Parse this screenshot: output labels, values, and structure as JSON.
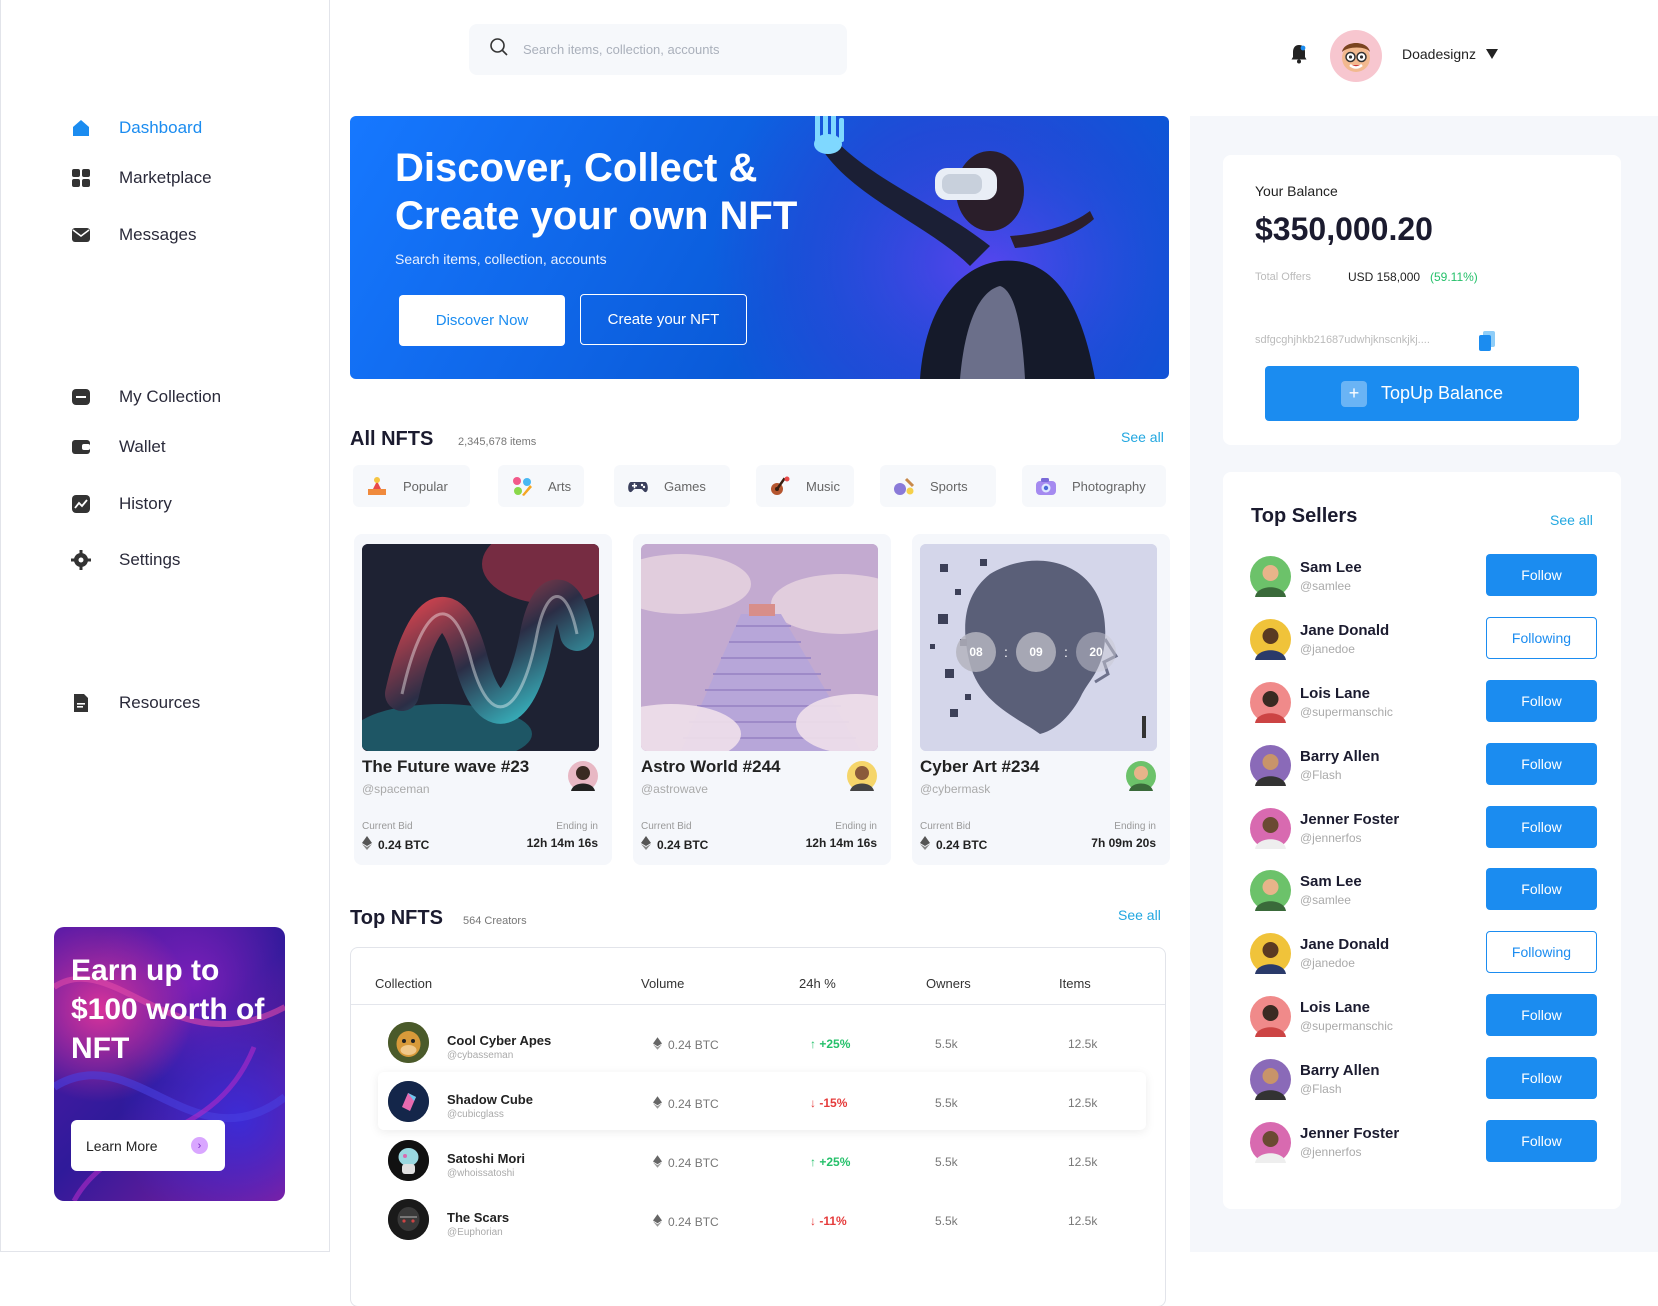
{
  "sidebar": {
    "nav": [
      {
        "label": "Dashboard",
        "icon": "home-icon"
      },
      {
        "label": "Marketplace",
        "icon": "grid-icon"
      },
      {
        "label": "Messages",
        "icon": "mail-icon"
      },
      {
        "label": "My Collection",
        "icon": "folder-icon"
      },
      {
        "label": "Wallet",
        "icon": "wallet-icon"
      },
      {
        "label": "History",
        "icon": "chart-icon"
      },
      {
        "label": "Settings",
        "icon": "gear-icon"
      },
      {
        "label": "Resources",
        "icon": "document-icon"
      }
    ],
    "promo": {
      "title": "Earn up to $100 worth of NFT",
      "button": "Learn More"
    }
  },
  "header": {
    "search_placeholder": "Search items, collection, accounts",
    "username": "Doadesignz"
  },
  "hero": {
    "title": "Discover, Collect & Create your own NFT",
    "subtitle": "Search items, collection, accounts",
    "primary_button": "Discover Now",
    "secondary_button": "Create your NFT"
  },
  "all_nfts": {
    "title": "All NFTS",
    "count": "2,345,678 items",
    "see_all": "See all",
    "categories": [
      "Popular",
      "Arts",
      "Games",
      "Music",
      "Sports",
      "Photography"
    ],
    "cards": [
      {
        "name": "The Future wave #23",
        "handle": "@spaceman",
        "bid_label": "Current Bid",
        "bid": "0.24 BTC",
        "end_label": "Ending in",
        "ending": "12h 14m 16s"
      },
      {
        "name": "Astro World #244",
        "handle": "@astrowave",
        "bid_label": "Current Bid",
        "bid": "0.24 BTC",
        "end_label": "Ending in",
        "ending": "12h 14m 16s"
      },
      {
        "name": "Cyber Art #234",
        "handle": "@cybermask",
        "bid_label": "Current Bid",
        "bid": "0.24 BTC",
        "end_label": "Ending in",
        "ending": "7h 09m 20s",
        "timer": [
          "08",
          "09",
          "20"
        ]
      }
    ]
  },
  "top_nfts": {
    "title": "Top NFTS",
    "count": "564 Creators",
    "see_all": "See all",
    "columns": [
      "Collection",
      "Volume",
      "24h %",
      "Owners",
      "Items"
    ],
    "rows": [
      {
        "name": "Cool Cyber Apes",
        "handle": "@cybasseman",
        "volume": "0.24 BTC",
        "change": "+25%",
        "direction": "up",
        "owners": "5.5k",
        "items": "12.5k"
      },
      {
        "name": "Shadow Cube",
        "handle": "@cubicglass",
        "volume": "0.24 BTC",
        "change": "-15%",
        "direction": "down",
        "owners": "5.5k",
        "items": "12.5k"
      },
      {
        "name": "Satoshi Mori",
        "handle": "@whoissatoshi",
        "volume": "0.24 BTC",
        "change": "+25%",
        "direction": "up",
        "owners": "5.5k",
        "items": "12.5k"
      },
      {
        "name": "The Scars",
        "handle": "@Euphorian",
        "volume": "0.24 BTC",
        "change": "-11%",
        "direction": "down",
        "owners": "5.5k",
        "items": "12.5k"
      }
    ]
  },
  "balance": {
    "label": "Your Balance",
    "amount": "$350,000.20",
    "offers_label": "Total Offers",
    "offers_usd": "USD 158,000",
    "offers_pct": "(59.11%)",
    "wallet": "sdfgcghjhkb21687udwhjknscnkjkj....",
    "topup": "TopUp Balance"
  },
  "top_sellers": {
    "title": "Top Sellers",
    "see_all": "See all",
    "sellers": [
      {
        "name": "Sam Lee",
        "handle": "@samlee",
        "action": "Follow"
      },
      {
        "name": "Jane Donald",
        "handle": "@janedoe",
        "action": "Following"
      },
      {
        "name": "Lois Lane",
        "handle": "@supermanschic",
        "action": "Follow"
      },
      {
        "name": "Barry Allen",
        "handle": "@Flash",
        "action": "Follow"
      },
      {
        "name": "Jenner Foster",
        "handle": "@jennerfos",
        "action": "Follow"
      },
      {
        "name": "Sam Lee",
        "handle": "@samlee",
        "action": "Follow"
      },
      {
        "name": "Jane Donald",
        "handle": "@janedoe",
        "action": "Following"
      },
      {
        "name": "Lois Lane",
        "handle": "@supermanschic",
        "action": "Follow"
      },
      {
        "name": "Barry Allen",
        "handle": "@Flash",
        "action": "Follow"
      },
      {
        "name": "Jenner Foster",
        "handle": "@jennerfos",
        "action": "Follow"
      }
    ]
  },
  "colors": {
    "accent": "#1b8cf0",
    "positive": "#25c06a",
    "negative": "#e53b3b"
  }
}
